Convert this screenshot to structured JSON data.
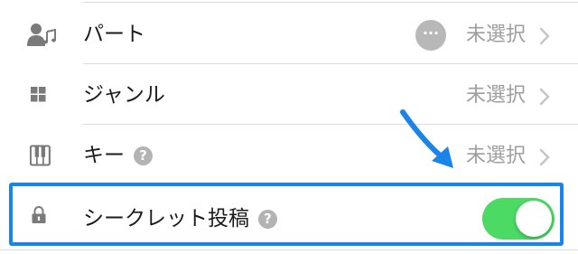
{
  "rows": {
    "part": {
      "label": "パート",
      "value": "未選択",
      "more_label": "···"
    },
    "genre": {
      "label": "ジャンル",
      "value": "未選択"
    },
    "key": {
      "label": "キー",
      "value": "未選択",
      "help": "?"
    },
    "secret": {
      "label": "シークレット投稿",
      "help": "?",
      "toggle_on": true
    }
  },
  "colors": {
    "highlight": "#1a84e8",
    "toggle_on": "#4cd964",
    "arrow": "#1a84e8",
    "secondary_text": "#9e9e9e"
  },
  "icons": {
    "part": "person-music-icon",
    "genre": "grid-icon",
    "key": "piano-icon",
    "secret": "lock-icon"
  }
}
